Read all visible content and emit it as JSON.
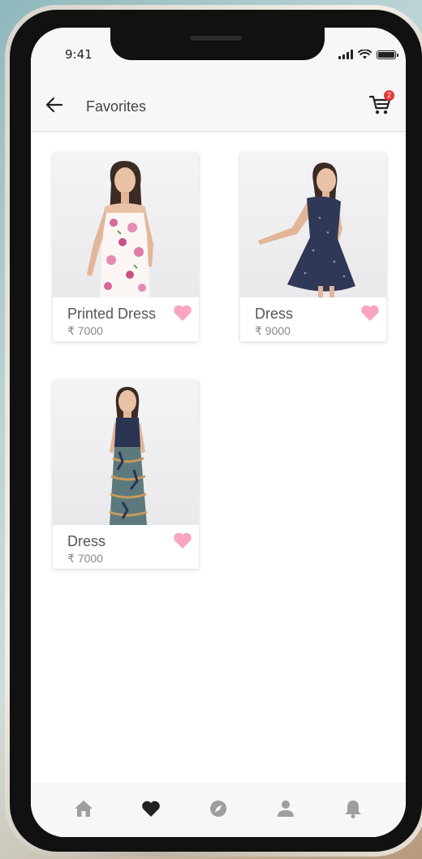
{
  "status_bar": {
    "time": "9:41"
  },
  "app_bar": {
    "title": "Favorites",
    "back_icon": "arrow-left-icon",
    "cart_icon": "shopping-cart-icon",
    "cart_count": "2"
  },
  "favorites": [
    {
      "name": "Printed Dress",
      "price": "₹ 7000",
      "image": "woman-in-floral-printed-dress"
    },
    {
      "name": "Dress",
      "price": "₹ 9000",
      "image": "woman-in-navy-polka-dot-dress"
    },
    {
      "name": "Dress",
      "price": "₹ 7000",
      "image": "woman-in-navy-and-patterned-maxi-dress"
    }
  ],
  "bottom_nav": [
    {
      "icon": "home-icon",
      "active": false
    },
    {
      "icon": "heart-icon",
      "active": true
    },
    {
      "icon": "compass-icon",
      "active": false
    },
    {
      "icon": "person-icon",
      "active": false
    },
    {
      "icon": "bell-icon",
      "active": false
    }
  ],
  "colors": {
    "heart": "#f8a5c2",
    "badge": "#e53935",
    "nav_inactive": "#9e9e9e",
    "nav_active": "#222222",
    "bar_background": "#f7f7f8"
  }
}
